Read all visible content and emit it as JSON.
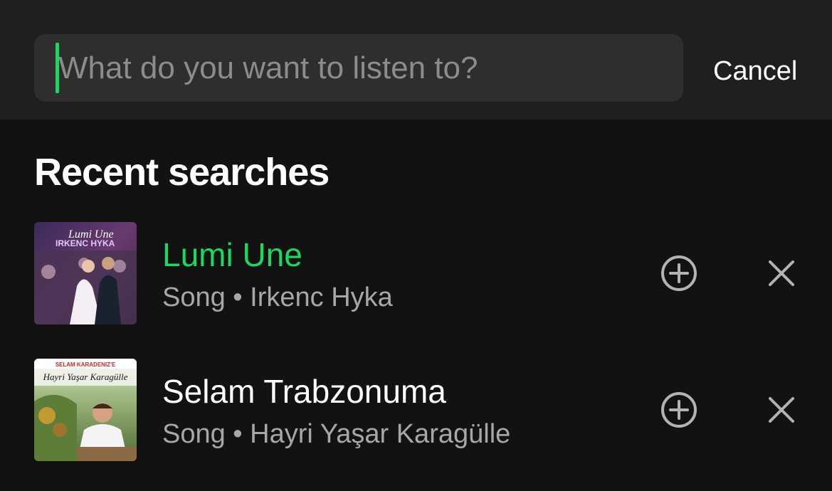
{
  "search": {
    "placeholder": "What do you want to listen to?",
    "value": "",
    "cancel_label": "Cancel"
  },
  "section": {
    "title": "Recent searches"
  },
  "recent_searches": [
    {
      "title": "Lumi Une",
      "subtitle": "Song • Irkenc Hyka",
      "active": true,
      "art_text": [
        "Lumi Une",
        "IRKENC HYKA"
      ]
    },
    {
      "title": "Selam Trabzonuma",
      "subtitle": "Song • Hayri Yaşar Karagülle",
      "active": false,
      "art_text": [
        "SELAM KARADENIZ'E",
        "Hayri Yaşar Karagülle"
      ]
    }
  ],
  "colors": {
    "accent": "#1ed760",
    "background": "#121212",
    "header": "#1f1f1f",
    "input": "#2e2e2e"
  },
  "icons": {
    "add": "plus-circle-icon",
    "remove": "close-icon"
  }
}
